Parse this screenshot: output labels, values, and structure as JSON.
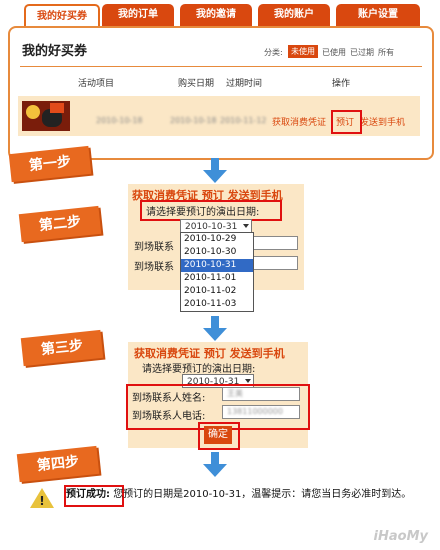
{
  "tabs": [
    {
      "label": "我的好买券",
      "active": true
    },
    {
      "label": "我的订单"
    },
    {
      "label": "我的邀请"
    },
    {
      "label": "我的账户"
    },
    {
      "label": "账户设置"
    }
  ],
  "panel": {
    "title": "我的好买券",
    "filter": {
      "label": "分类:",
      "options": [
        "未使用",
        "已使用",
        "已过期",
        "所有"
      ],
      "selected": "未使用"
    },
    "columns": [
      "活动项目",
      "购买日期",
      "过期时间",
      "操作"
    ],
    "row": {
      "item": "2010-10-18",
      "purchase_date": "2010-10-18",
      "expire_date": "2010-11-12",
      "actions": [
        "获取消费凭证",
        "预订",
        "发送到手机"
      ]
    }
  },
  "steps": {
    "step1": "第一步",
    "step2": "第二步",
    "step3": "第三步",
    "step4": "第四步"
  },
  "step2": {
    "header": "获取消费凭证  预订  发送到手机",
    "prompt": "请选择要预订的演出日期:",
    "selected_date": "2010-10-31",
    "options": [
      "2010-10-29",
      "2010-10-30",
      "2010-10-31",
      "2010-11-01",
      "2010-11-02",
      "2010-11-03"
    ],
    "label_name": "到场联系",
    "label_phone": "到场联系"
  },
  "step3": {
    "header": "获取消费凭证  预订  发送到手机",
    "prompt": "请选择要预订的演出日期:",
    "selected_date": "2010-10-31",
    "label_name": "到场联系人姓名:",
    "value_name": "王美",
    "label_phone": "到场联系人电话:",
    "value_phone": "13811000000",
    "confirm": "确定"
  },
  "result": {
    "status": "预订成功:",
    "message": "您预订的日期是2010-10-31，温馨提示：请您当日务必准时到达。"
  },
  "watermark": "iHaoMy",
  "colors": {
    "accent": "#d9480f",
    "highlight": "#e01010",
    "band": "#fbe7c6"
  }
}
